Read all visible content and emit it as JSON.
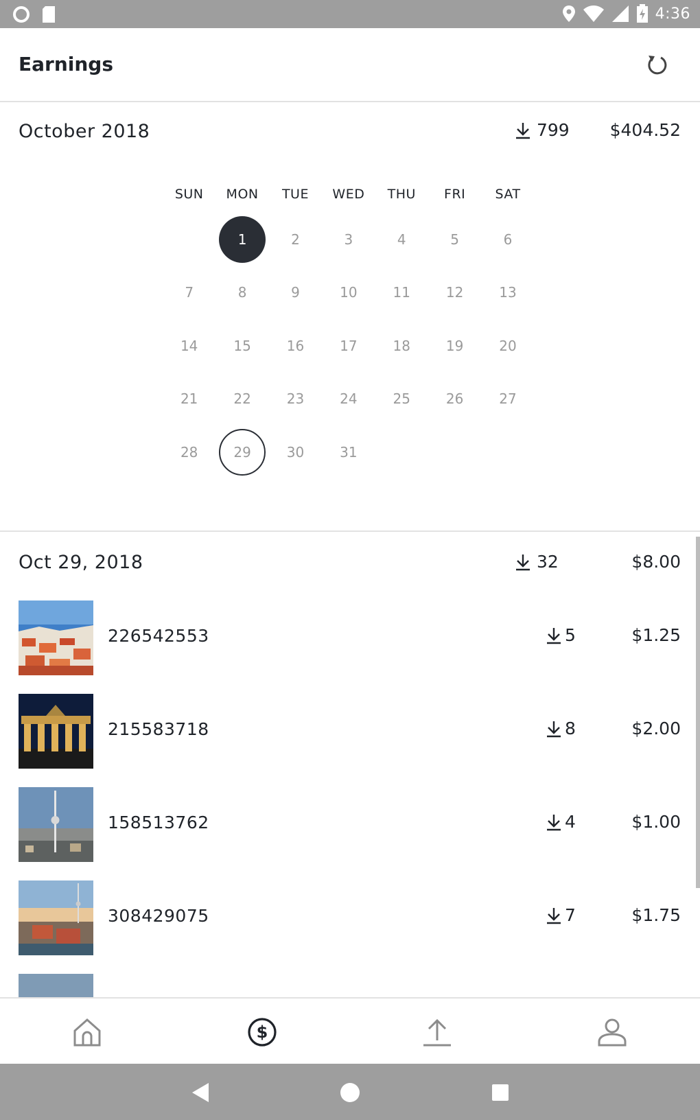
{
  "status_bar": {
    "time": "4:36"
  },
  "header": {
    "title": "Earnings"
  },
  "month_summary": {
    "title": "October 2018",
    "downloads": "799",
    "amount": "$404.52"
  },
  "calendar": {
    "weekdays": [
      "SUN",
      "MON",
      "TUE",
      "WED",
      "THU",
      "FRI",
      "SAT"
    ],
    "leading_blanks": 1,
    "days": [
      "1",
      "2",
      "3",
      "4",
      "5",
      "6",
      "7",
      "8",
      "9",
      "10",
      "11",
      "12",
      "13",
      "14",
      "15",
      "16",
      "17",
      "18",
      "19",
      "20",
      "21",
      "22",
      "23",
      "24",
      "25",
      "26",
      "27",
      "28",
      "29",
      "30",
      "31"
    ],
    "selected_day": "1",
    "today_day": "29"
  },
  "day_summary": {
    "title": "Oct 29, 2018",
    "downloads": "32",
    "amount": "$8.00"
  },
  "photos": [
    {
      "id": "226542553",
      "downloads": "5",
      "amount": "$1.25"
    },
    {
      "id": "215583718",
      "downloads": "8",
      "amount": "$2.00"
    },
    {
      "id": "158513762",
      "downloads": "4",
      "amount": "$1.00"
    },
    {
      "id": "308429075",
      "downloads": "7",
      "amount": "$1.75"
    }
  ],
  "bottom_nav": [
    {
      "icon": "home-icon",
      "active": false
    },
    {
      "icon": "dollar-circle-icon",
      "active": true
    },
    {
      "icon": "upload-icon",
      "active": false
    },
    {
      "icon": "profile-icon",
      "active": false
    }
  ],
  "colors": {
    "accent": "#2a2e35",
    "muted": "#9a9a9a",
    "system_bar": "#9e9e9e"
  }
}
